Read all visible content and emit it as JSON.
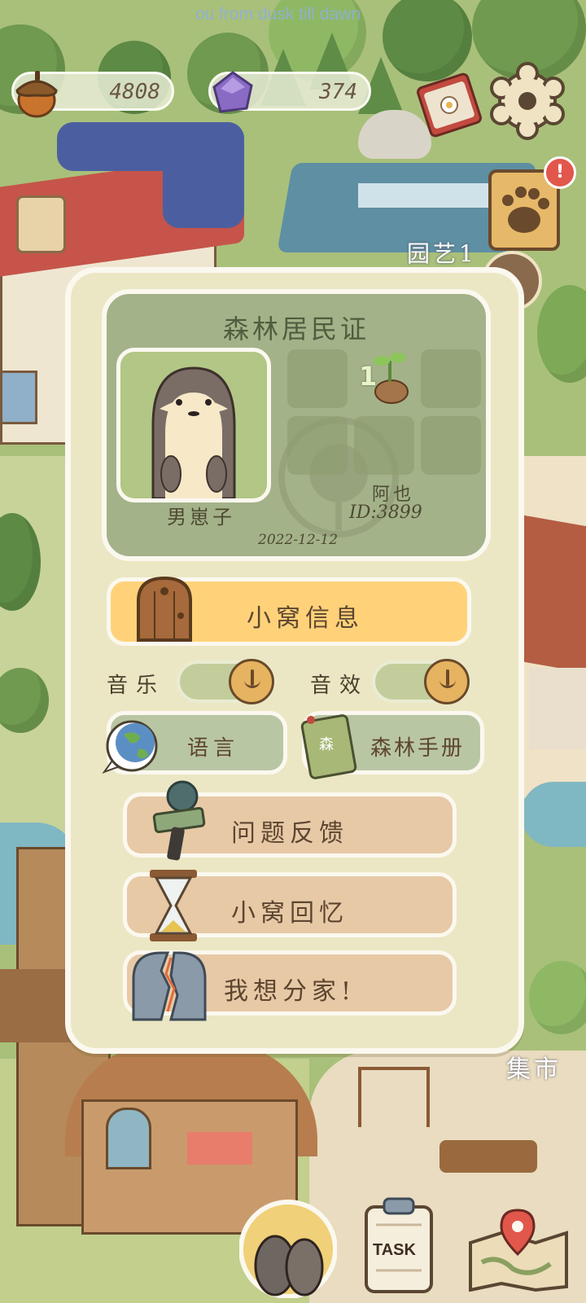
{
  "banner": {
    "text": "ou from dusk till dawn"
  },
  "hud": {
    "acorns": {
      "icon": "acorn-icon",
      "value": "4808"
    },
    "gems": {
      "icon": "gem-icon",
      "value": "374"
    },
    "book_icon": "book-icon",
    "settings_icon": "gear-icon",
    "paw_icon": "paw-icon",
    "alert": "!"
  },
  "scene_labels": {
    "garden": "园艺1",
    "market": "集市"
  },
  "panel": {
    "card": {
      "title": "森林居民证",
      "pet_name": "男崽子",
      "owner_name": "阿也",
      "owner_id": "ID:3899",
      "date": "2022-12-12",
      "badge_level": "1",
      "badge_icon": "sprout-icon"
    },
    "home_info": "小窝信息",
    "music_label": "音乐",
    "sfx_label": "音效",
    "music_on": true,
    "sfx_on": true,
    "language": "语言",
    "handbook": "森林手册",
    "handbook_cover": "森",
    "feedback": "问题反馈",
    "memories": "小窝回忆",
    "leave_home": "我想分家!"
  },
  "bottom": {
    "task": "TASK",
    "avatar_icon": "character-icon",
    "map_icon": "map-icon"
  },
  "colors": {
    "panel_bg": "#ebe7c4",
    "card_bg": "#a4b289",
    "home_info_bg": "#ffd27a",
    "sage_bg": "#b9c6a4",
    "peach_bg": "#e7c9a6"
  }
}
